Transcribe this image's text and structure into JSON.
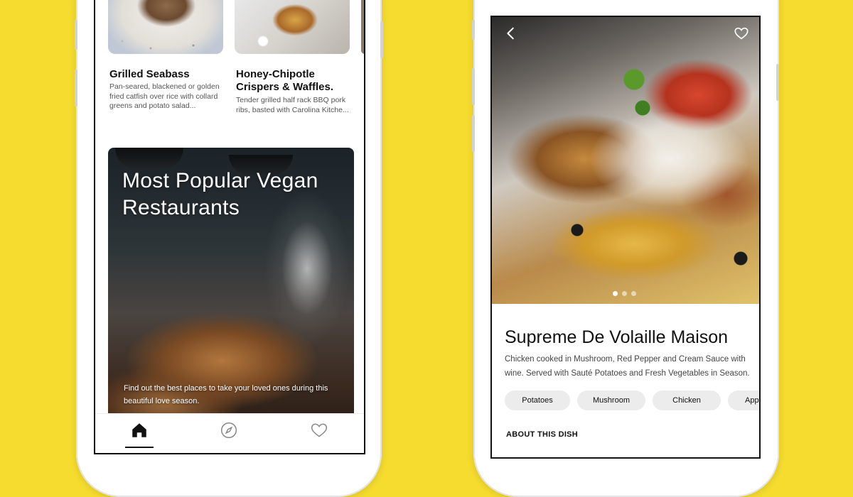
{
  "colors": {
    "background": "#F5DC2E",
    "text": "#111111",
    "chip_bg": "#ECECEC"
  },
  "left_screen": {
    "dishes": [
      {
        "title": "Grilled Seabass",
        "description": "Pan-seared, blackened or golden fried catfish over rice with collard greens and potato salad..."
      },
      {
        "title": "Honey-Chipotle Crispers & Waffles.",
        "description": "Tender grilled half rack BBQ pork ribs, basted with Carolina Kitche..."
      }
    ],
    "feature": {
      "title": "Most Popular Vegan Restaurants",
      "subtitle": "Find out the best places to take your loved ones during this beautiful love season."
    },
    "tabbar": {
      "tabs": [
        {
          "icon": "home-icon",
          "active": true
        },
        {
          "icon": "compass-icon",
          "active": false
        },
        {
          "icon": "heart-icon",
          "active": false
        }
      ]
    }
  },
  "right_screen": {
    "hero": {
      "back_icon": "chevron-left-icon",
      "favorite_icon": "heart-icon",
      "slide_count": 3,
      "active_slide": 1
    },
    "dish": {
      "title": "Supreme De Volaille Maison",
      "description": "Chicken cooked in Mushroom, Red Pepper and Cream Sauce with wine. Served with Sauté Potatoes and Fresh Vegetables in Season."
    },
    "tags": [
      "Potatoes",
      "Mushroom",
      "Chicken",
      "Apples"
    ],
    "section_heading": "ABOUT THIS DISH"
  }
}
